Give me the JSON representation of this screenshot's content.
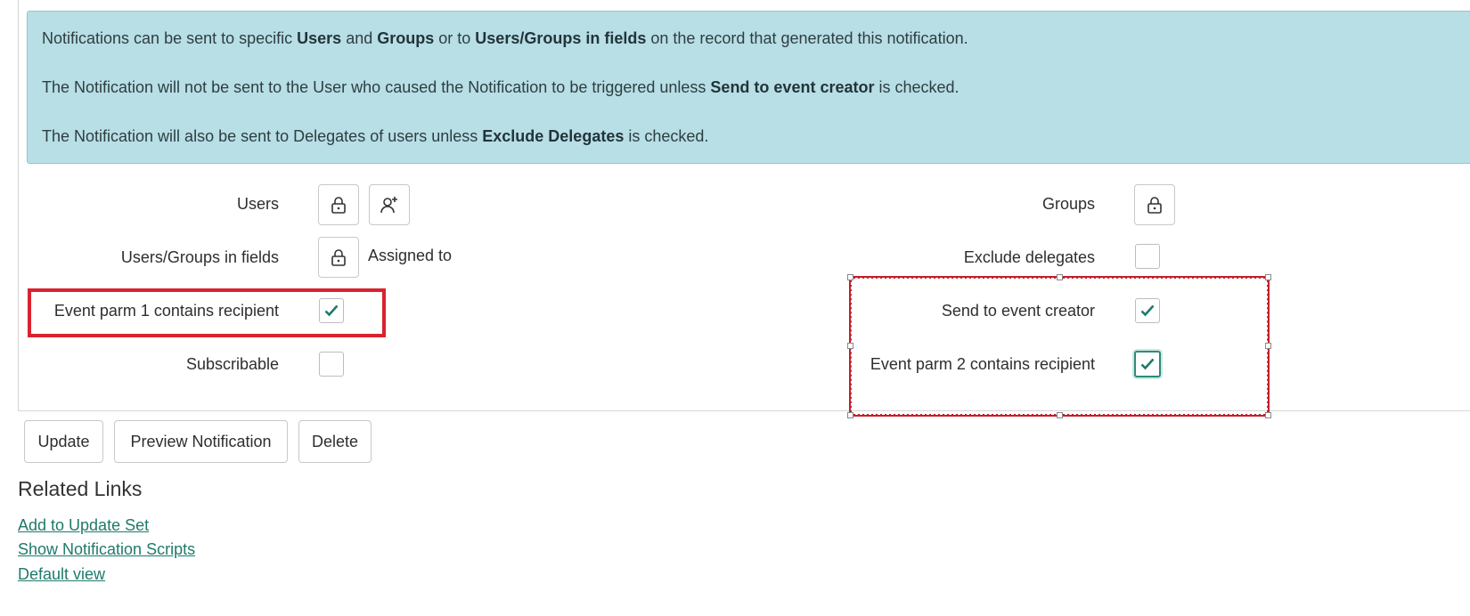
{
  "info": {
    "line1": {
      "t1": "Notifications can be sent to specific ",
      "b1": "Users",
      "t2": " and ",
      "b2": "Groups",
      "t3": " or to ",
      "b3": "Users/Groups in fields",
      "t4": " on the record that generated this notification."
    },
    "line2": {
      "t1": "The Notification will not be sent to the User who caused the Notification to be triggered unless ",
      "b1": "Send to event creator",
      "t2": " is checked."
    },
    "line3": {
      "t1": "The Notification will also be sent to Delegates of users unless ",
      "b1": "Exclude Delegates",
      "t2": " is checked."
    }
  },
  "fields": {
    "users_label": "Users",
    "users_groups_fields_label": "Users/Groups in fields",
    "users_groups_fields_value": "Assigned to",
    "event_parm1_label": "Event parm 1 contains recipient",
    "event_parm1_checked": true,
    "subscribable_label": "Subscribable",
    "subscribable_checked": false,
    "groups_label": "Groups",
    "exclude_delegates_label": "Exclude delegates",
    "exclude_delegates_checked": false,
    "send_to_creator_label": "Send to event creator",
    "send_to_creator_checked": true,
    "event_parm2_label": "Event parm 2 contains recipient",
    "event_parm2_checked": true
  },
  "buttons": {
    "update": "Update",
    "preview": "Preview Notification",
    "delete": "Delete"
  },
  "related": {
    "title": "Related Links",
    "links": [
      "Add to Update Set",
      "Show Notification Scripts",
      "Default view"
    ]
  },
  "colors": {
    "info_bg": "#b7dfe5",
    "accent": "#1f7a6b",
    "highlight": "#d9232e"
  },
  "icons": {
    "lock": "lock-icon",
    "add_user": "add-user-icon",
    "check": "checkmark-icon"
  }
}
